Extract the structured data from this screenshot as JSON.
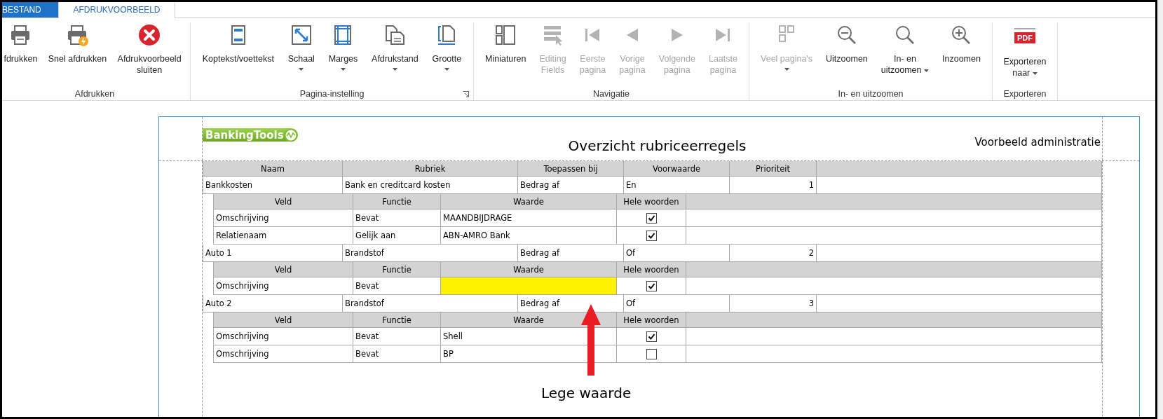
{
  "tabs": [
    {
      "label": "BESTAND",
      "kind": "file",
      "selected": false
    },
    {
      "label": "AFDRUKVOORBEELD",
      "kind": "tab",
      "selected": true
    }
  ],
  "ribbon": {
    "groups": [
      {
        "label": "Afdrukken",
        "buttons": [
          {
            "label": "fdrukken",
            "disabled": false
          },
          {
            "label": "Snel afdrukken",
            "disabled": false
          },
          {
            "label": "Afdrukvoorbeeld\nsluiten",
            "disabled": false
          }
        ]
      },
      {
        "label": "Pagina-instelling",
        "launcher": true,
        "buttons": [
          {
            "label": "Koptekst/voettekst",
            "disabled": false
          },
          {
            "label": "Schaal",
            "disabled": false,
            "kind": "dropdown"
          },
          {
            "label": "Marges",
            "disabled": false,
            "kind": "dropdown"
          },
          {
            "label": "Afdrukstand",
            "disabled": false,
            "kind": "dropdown"
          },
          {
            "label": "Grootte",
            "disabled": false,
            "kind": "dropdown"
          }
        ]
      },
      {
        "label": "Navigatie",
        "buttons": [
          {
            "label": "Miniaturen",
            "disabled": false
          },
          {
            "label": "Editing\nFields",
            "disabled": true
          },
          {
            "label": "Eerste\npagina",
            "disabled": true
          },
          {
            "label": "Vorige\npagina",
            "disabled": true
          },
          {
            "label": "Volgende\npagina",
            "disabled": true
          },
          {
            "label": "Laatste\npagina",
            "disabled": true
          }
        ]
      },
      {
        "label": "In- en uitzoomen",
        "buttons": [
          {
            "label": "Veel pagina's",
            "disabled": true,
            "kind": "dropdown"
          },
          {
            "label": "Uitzoomen",
            "disabled": false
          },
          {
            "label": "In- en\nuitzoomen",
            "disabled": false,
            "kind": "inlinedropdown"
          },
          {
            "label": "Inzoomen",
            "disabled": false
          }
        ]
      },
      {
        "label": "Exporteren",
        "buttons": [
          {
            "label": "Exporteren\nnaar",
            "disabled": false,
            "kind": "inlinedropdown",
            "icon_text": "PDF"
          }
        ]
      }
    ]
  },
  "report": {
    "logo": "BankingTools",
    "title": "Overzicht rubriceerregels",
    "subtitle": "Voorbeeld administratie",
    "columns": [
      "Naam",
      "Rubriek",
      "Toepassen bij",
      "Voorwaarde",
      "Prioriteit"
    ],
    "rules": [
      {
        "naam": "Bankkosten",
        "rubriek": "Bank en creditcard kosten",
        "toepassen_bij": "Bedrag af",
        "voorwaarde": "En",
        "prioriteit": "1",
        "condition_columns": [
          "Veld",
          "Functie",
          "Waarde",
          "Hele woorden"
        ],
        "conditions": [
          {
            "veld": "Omschrijving",
            "functie": "Bevat",
            "waarde": "MAANDBIJDRAGE",
            "hele_woorden": true,
            "highlighted": false
          },
          {
            "veld": "Relatienaam",
            "functie": "Gelijk aan",
            "waarde": "ABN-AMRO Bank",
            "hele_woorden": true,
            "highlighted": false
          }
        ]
      },
      {
        "naam": "Auto 1",
        "rubriek": "Brandstof",
        "toepassen_bij": "Bedrag af",
        "voorwaarde": "Of",
        "prioriteit": "2",
        "condition_columns": [
          "Veld",
          "Functie",
          "Waarde",
          "Hele woorden"
        ],
        "conditions": [
          {
            "veld": "Omschrijving",
            "functie": "Bevat",
            "hele_woorden": true,
            "highlighted": true
          }
        ]
      },
      {
        "naam": "Auto 2",
        "rubriek": "Brandstof",
        "toepassen_bij": "Bedrag af",
        "voorwaarde": "Of",
        "prioriteit": "3",
        "condition_columns": [
          "Veld",
          "Functie",
          "Waarde",
          "Hele woorden"
        ],
        "conditions": [
          {
            "veld": "Omschrijving",
            "functie": "Bevat",
            "waarde": "Shell",
            "hele_woorden": true,
            "highlighted": false
          },
          {
            "veld": "Omschrijving",
            "functie": "Bevat",
            "waarde": "BP",
            "hele_woorden": false,
            "highlighted": false
          }
        ]
      }
    ]
  },
  "annotation": {
    "label": "Lege waarde"
  }
}
